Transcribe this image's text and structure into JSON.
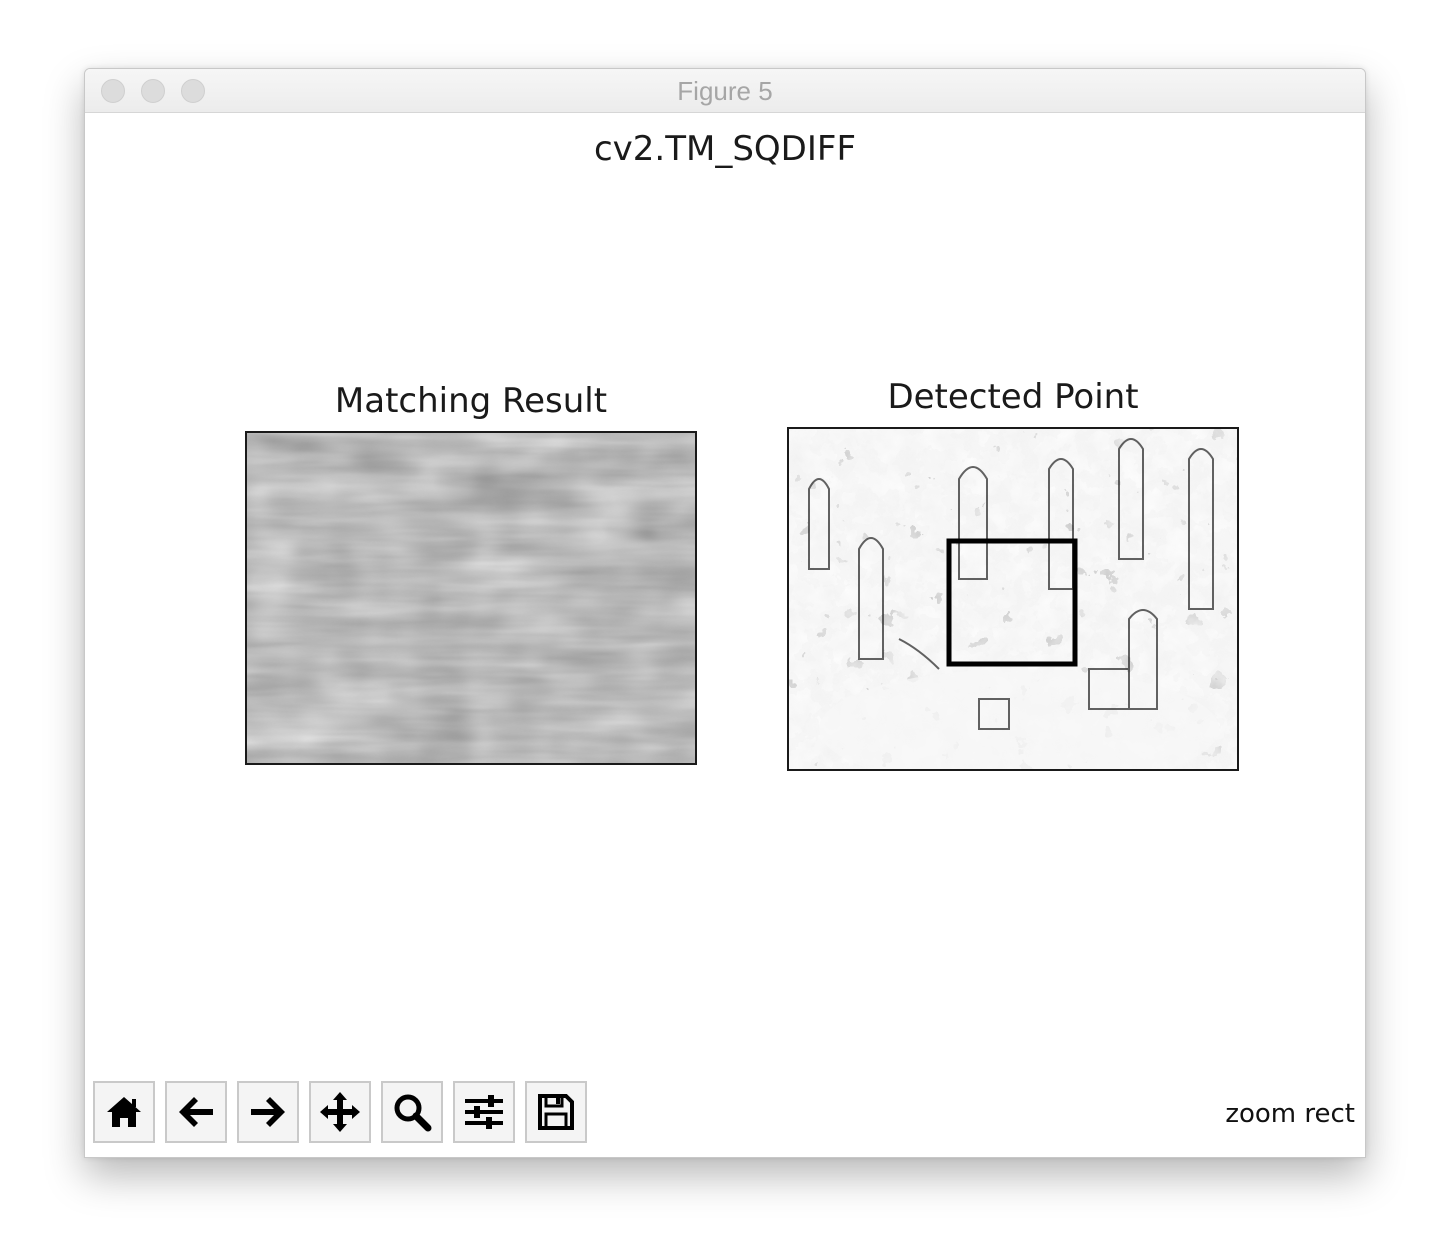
{
  "window": {
    "title": "Figure 5"
  },
  "figure": {
    "suptitle": "cv2.TM_SQDIFF",
    "left_axes": {
      "title": "Matching Result"
    },
    "right_axes": {
      "title": "Detected Point"
    }
  },
  "toolbar": {
    "buttons": [
      {
        "name": "home",
        "icon": "home-icon"
      },
      {
        "name": "back",
        "icon": "arrow-left-icon"
      },
      {
        "name": "forward",
        "icon": "arrow-right-icon"
      },
      {
        "name": "pan",
        "icon": "move-icon"
      },
      {
        "name": "zoom",
        "icon": "magnifier-icon"
      },
      {
        "name": "configure-subplots",
        "icon": "sliders-icon"
      },
      {
        "name": "save",
        "icon": "floppy-disk-icon"
      }
    ],
    "status": "zoom rect"
  },
  "colors": {
    "titlebar": "#ececec",
    "traffic_light": "#dcdcdc",
    "axes_border": "#1a1a1a",
    "button_bg": "#f4f4f4"
  }
}
